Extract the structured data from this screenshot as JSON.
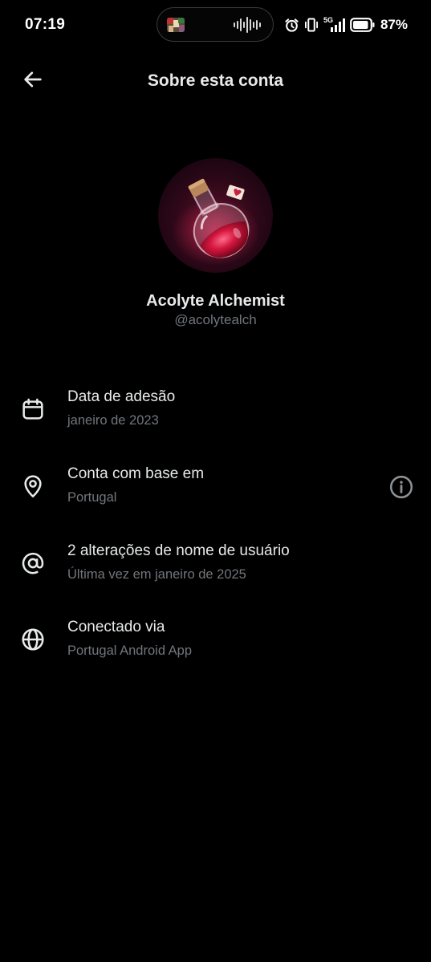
{
  "status_bar": {
    "time": "07:19",
    "battery": "87%",
    "network": "5G",
    "icons": [
      "media-thumbnail-icon",
      "audio-wave-icon",
      "alarm-icon",
      "vibrate-icon",
      "signal-5g-icon",
      "battery-icon"
    ]
  },
  "header": {
    "title": "Sobre esta conta",
    "back_icon": "arrow-left-icon"
  },
  "profile": {
    "name": "Acolyte Alchemist",
    "handle": "@acolytealch",
    "avatar_icon": "potion-bottle-avatar"
  },
  "details": [
    {
      "icon": "calendar-icon",
      "title": "Data de adesão",
      "subtitle": "janeiro de 2023"
    },
    {
      "icon": "location-pin-icon",
      "title": "Conta com base em",
      "subtitle": "Portugal",
      "help_icon": "info-circle-icon"
    },
    {
      "icon": "at-sign-icon",
      "title": "2 alterações de nome de usuário",
      "subtitle": "Última vez em janeiro de 2025"
    },
    {
      "icon": "globe-icon",
      "title": "Conectado via",
      "subtitle": "Portugal Android App"
    }
  ],
  "colors": {
    "background": "#000000",
    "primary_text": "#e7e9ea",
    "secondary_text": "#71767b",
    "avatar_accent": "#c0143c"
  }
}
